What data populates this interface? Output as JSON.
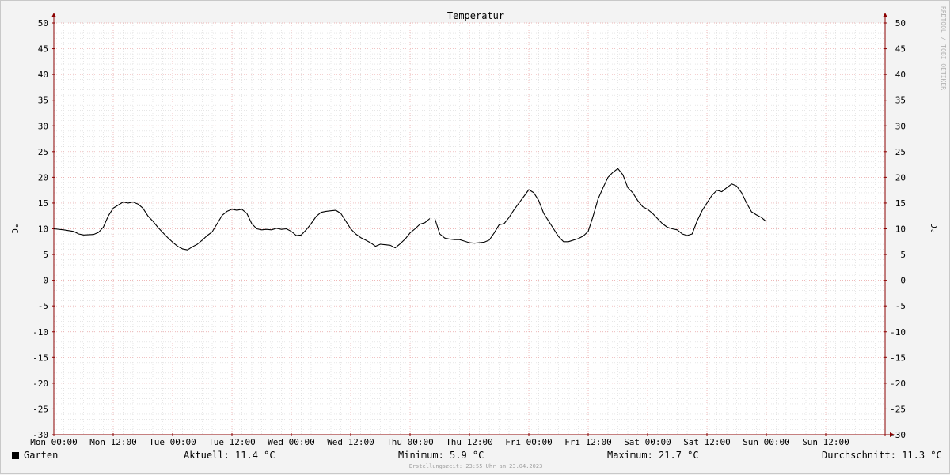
{
  "chart_data": {
    "type": "line",
    "title": "Temperatur",
    "ylabel": "°C",
    "ylabel_right": "°C",
    "ylim": [
      -30,
      50
    ],
    "y_ticks": [
      50,
      45,
      40,
      35,
      30,
      25,
      20,
      15,
      10,
      5,
      0,
      -5,
      -10,
      -15,
      -20,
      -25,
      -30
    ],
    "x_unit": "hours",
    "xlim": [
      0,
      168
    ],
    "x_ticks": [
      {
        "x": 0,
        "label": "Mon 00:00"
      },
      {
        "x": 12,
        "label": "Mon 12:00"
      },
      {
        "x": 24,
        "label": "Tue 00:00"
      },
      {
        "x": 36,
        "label": "Tue 12:00"
      },
      {
        "x": 48,
        "label": "Wed 00:00"
      },
      {
        "x": 60,
        "label": "Wed 12:00"
      },
      {
        "x": 72,
        "label": "Thu 00:00"
      },
      {
        "x": 84,
        "label": "Thu 12:00"
      },
      {
        "x": 96,
        "label": "Fri 00:00"
      },
      {
        "x": 108,
        "label": "Fri 12:00"
      },
      {
        "x": 120,
        "label": "Sat 00:00"
      },
      {
        "x": 132,
        "label": "Sat 12:00"
      },
      {
        "x": 144,
        "label": "Sun 00:00"
      },
      {
        "x": 156,
        "label": "Sun 12:00"
      }
    ],
    "grid": true,
    "series": [
      {
        "name": "Garten",
        "color": "#000000",
        "segments": [
          [
            [
              0,
              10.0
            ],
            [
              2,
              9.8
            ],
            [
              4,
              9.5
            ],
            [
              5,
              9.0
            ],
            [
              6,
              8.8
            ],
            [
              8,
              8.9
            ],
            [
              9,
              9.3
            ],
            [
              10,
              10.3
            ],
            [
              11,
              12.5
            ],
            [
              12,
              14.0
            ],
            [
              13,
              14.6
            ],
            [
              14,
              15.2
            ],
            [
              15,
              15.0
            ],
            [
              16,
              15.2
            ],
            [
              17,
              14.8
            ],
            [
              18,
              14.0
            ],
            [
              19,
              12.5
            ],
            [
              20,
              11.5
            ],
            [
              21,
              10.3
            ],
            [
              22,
              9.3
            ],
            [
              23,
              8.3
            ],
            [
              24,
              7.4
            ],
            [
              25,
              6.6
            ],
            [
              26,
              6.1
            ],
            [
              27,
              5.9
            ],
            [
              28,
              6.5
            ],
            [
              29,
              7.0
            ],
            [
              30,
              7.8
            ],
            [
              31,
              8.7
            ],
            [
              32,
              9.4
            ],
            [
              33,
              11.0
            ],
            [
              34,
              12.6
            ],
            [
              35,
              13.4
            ],
            [
              36,
              13.8
            ],
            [
              37,
              13.6
            ],
            [
              38,
              13.8
            ],
            [
              39,
              13.0
            ],
            [
              40,
              11.0
            ],
            [
              41,
              10.0
            ],
            [
              42,
              9.8
            ],
            [
              43,
              9.9
            ],
            [
              44,
              9.8
            ],
            [
              45,
              10.1
            ],
            [
              46,
              9.9
            ],
            [
              47,
              10.0
            ],
            [
              48,
              9.5
            ],
            [
              49,
              8.7
            ],
            [
              50,
              8.8
            ],
            [
              51,
              9.8
            ],
            [
              52,
              11.0
            ],
            [
              53,
              12.4
            ],
            [
              54,
              13.2
            ],
            [
              55,
              13.4
            ],
            [
              56,
              13.5
            ],
            [
              57,
              13.6
            ],
            [
              58,
              13.0
            ],
            [
              59,
              11.5
            ],
            [
              60,
              10.0
            ],
            [
              61,
              9.0
            ],
            [
              62,
              8.3
            ],
            [
              63,
              7.8
            ],
            [
              64,
              7.3
            ],
            [
              65,
              6.6
            ],
            [
              66,
              7.0
            ],
            [
              67,
              6.9
            ],
            [
              68,
              6.8
            ],
            [
              69,
              6.3
            ],
            [
              70,
              7.1
            ],
            [
              71,
              8.0
            ],
            [
              72,
              9.2
            ],
            [
              73,
              10.0
            ],
            [
              74,
              10.9
            ],
            [
              75,
              11.2
            ],
            [
              76,
              12.0
            ]
          ],
          [
            [
              77,
              12.0
            ],
            [
              78,
              9.0
            ],
            [
              79,
              8.2
            ],
            [
              80,
              8.0
            ],
            [
              81,
              7.9
            ],
            [
              82,
              7.9
            ],
            [
              83,
              7.6
            ],
            [
              84,
              7.3
            ],
            [
              85,
              7.2
            ],
            [
              86,
              7.3
            ],
            [
              87,
              7.4
            ],
            [
              88,
              7.8
            ],
            [
              89,
              9.2
            ],
            [
              90,
              10.8
            ],
            [
              91,
              11.0
            ],
            [
              92,
              12.2
            ],
            [
              93,
              13.7
            ],
            [
              94,
              15.0
            ],
            [
              95,
              16.3
            ],
            [
              96,
              17.6
            ],
            [
              97,
              17.0
            ],
            [
              98,
              15.5
            ],
            [
              99,
              13.0
            ],
            [
              100,
              11.5
            ],
            [
              101,
              10.0
            ],
            [
              102,
              8.5
            ],
            [
              103,
              7.5
            ],
            [
              104,
              7.5
            ],
            [
              105,
              7.8
            ],
            [
              106,
              8.1
            ],
            [
              107,
              8.6
            ],
            [
              108,
              9.5
            ],
            [
              109,
              12.5
            ],
            [
              110,
              15.8
            ],
            [
              111,
              18.0
            ],
            [
              112,
              20.0
            ],
            [
              113,
              21.0
            ],
            [
              114,
              21.7
            ],
            [
              115,
              20.5
            ],
            [
              116,
              18.0
            ],
            [
              117,
              17.0
            ],
            [
              118,
              15.5
            ],
            [
              119,
              14.3
            ],
            [
              120,
              13.8
            ],
            [
              121,
              13.0
            ],
            [
              122,
              12.0
            ],
            [
              123,
              11.0
            ],
            [
              124,
              10.3
            ],
            [
              125,
              10.0
            ],
            [
              126,
              9.8
            ],
            [
              127,
              9.0
            ],
            [
              128,
              8.7
            ],
            [
              129,
              9.0
            ],
            [
              130,
              11.5
            ],
            [
              131,
              13.5
            ],
            [
              132,
              15.0
            ],
            [
              133,
              16.5
            ],
            [
              134,
              17.5
            ],
            [
              135,
              17.2
            ],
            [
              136,
              18.0
            ],
            [
              137,
              18.7
            ],
            [
              138,
              18.3
            ],
            [
              139,
              17.0
            ],
            [
              140,
              15.0
            ],
            [
              141,
              13.3
            ],
            [
              142,
              12.7
            ],
            [
              143,
              12.2
            ],
            [
              144,
              11.4
            ]
          ]
        ]
      }
    ]
  },
  "legend": {
    "series_name": "Garten",
    "current": "Aktuell: 11.4 °C",
    "minimum": "Minimum: 5.9 °C",
    "maximum": "Maximum: 21.7 °C",
    "average": "Durchschnitt: 11.3 °C"
  },
  "watermark": "RRDTOOL / TOBI OETIKER",
  "footer": "Erstellungszeit: 23:55 Uhr am 23.04.2023",
  "colors": {
    "background": "#f3f3f3",
    "plot_background": "#ffffff",
    "major_grid": "#e8a0a0",
    "minor_grid": "#d8d8d8",
    "axis": "#8b0000",
    "line": "#000000"
  }
}
